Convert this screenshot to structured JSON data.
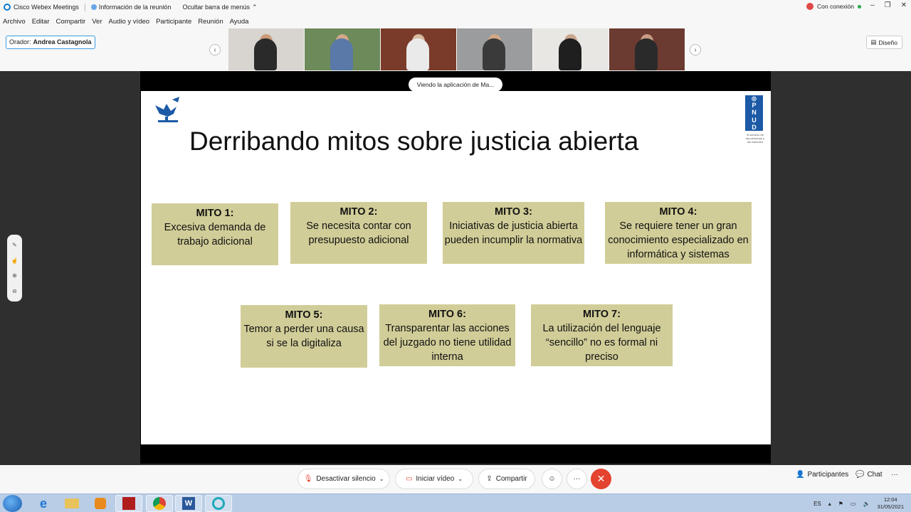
{
  "titlebar": {
    "app_name": "Cisco Webex Meetings",
    "meeting_info": "Información de la reunión",
    "hide_menu_bar": "Ocultar barra de menús",
    "connection": "Con conexión"
  },
  "menu": [
    "Archivo",
    "Editar",
    "Compartir",
    "Ver",
    "Audio y vídeo",
    "Participante",
    "Reunión",
    "Ayuda"
  ],
  "speaker": {
    "label": "Orador:",
    "name": "Andrea Castagnola"
  },
  "layout_button": "Diseño",
  "viewing_banner": "Viendo la aplicación de Ma...",
  "slide": {
    "title": "Derribando mitos sobre justicia abierta",
    "logo_letters": [
      "P",
      "N",
      "U",
      "D"
    ],
    "logo_subtitle": "Al servicio de las personas y las naciones",
    "myths": [
      {
        "title": "MITO 1:",
        "text": "Excesiva demanda de trabajo adicional"
      },
      {
        "title": "MITO 2:",
        "text": "Se necesita contar con presupuesto adicional"
      },
      {
        "title": "MITO 3:",
        "text": "Iniciativas de justicia abierta pueden incumplir la normativa"
      },
      {
        "title": "MITO 4:",
        "text": "Se requiere tener un gran conocimiento especializado en informática y sistemas"
      },
      {
        "title": "MITO 5:",
        "text": "Temor a perder una causa si se la digitaliza"
      },
      {
        "title": "MITO 6:",
        "text": "Transparentar las acciones del juzgado no tiene utilidad interna"
      },
      {
        "title": "MITO 7:",
        "text": "La utilización del lenguaje “sencillo” no es formal ni preciso"
      }
    ]
  },
  "controls": {
    "mute": "Desactivar silencio",
    "video": "Iniciar vídeo",
    "share": "Compartir",
    "participants": "Participantes",
    "chat": "Chat"
  },
  "tray": {
    "lang": "ES",
    "time": "12:04",
    "date": "31/05/2021"
  },
  "colors": {
    "accent": "#0a7bd4",
    "myth_box": "#d1cd98",
    "end_call": "#e3432f",
    "pnud_blue": "#1c5aa6"
  }
}
